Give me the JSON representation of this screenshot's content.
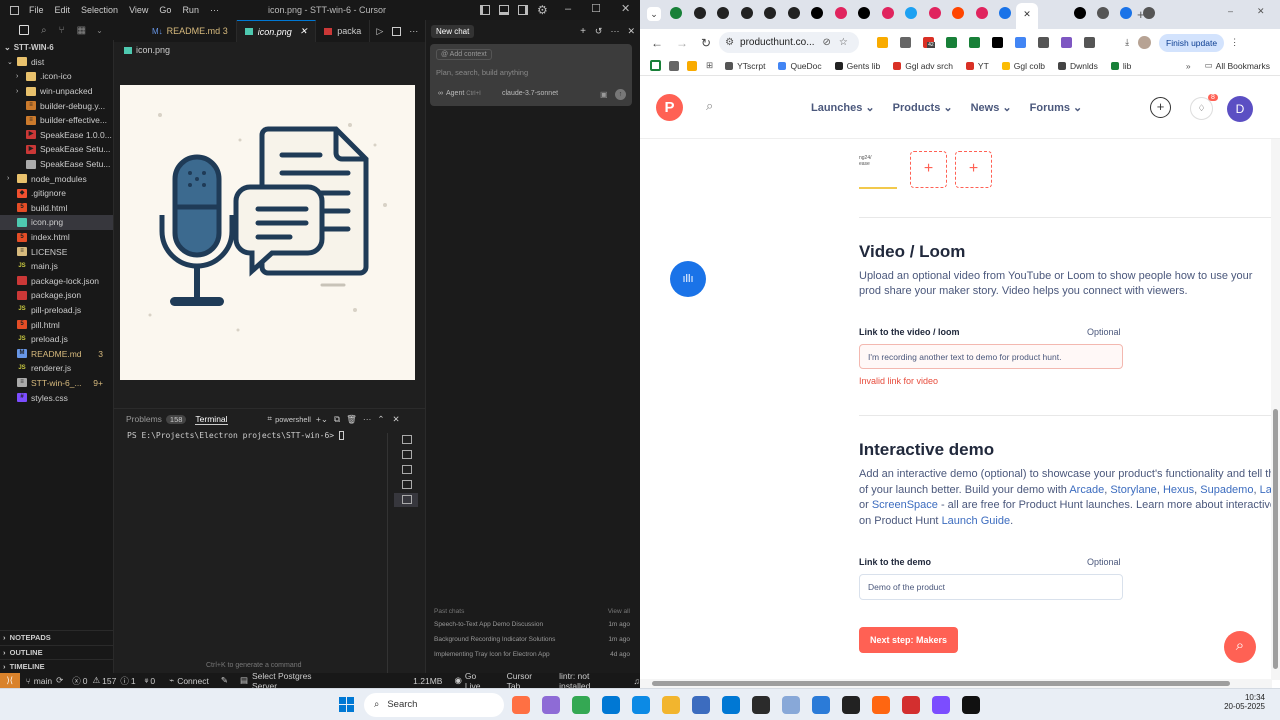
{
  "vscode": {
    "menu": [
      "File",
      "Edit",
      "Selection",
      "View",
      "Go",
      "Run",
      "···"
    ],
    "window_title": "icon.png - STT-win-6 - Cursor",
    "tabs": [
      {
        "label": "README.md",
        "badge": "3"
      },
      {
        "label": "icon.png"
      },
      {
        "label": "packa"
      }
    ],
    "breadcrumb": "icon.png",
    "explorer_root": "STT-WIN-6",
    "tree": [
      {
        "label": "dist",
        "indent": 1,
        "icon": "chev-down",
        "kind": "folder"
      },
      {
        "label": ".icon-ico",
        "indent": 2,
        "icon": "chev",
        "kind": "folder"
      },
      {
        "label": "win-unpacked",
        "indent": 2,
        "icon": "chev",
        "kind": "folder"
      },
      {
        "label": "builder-debug.y...",
        "indent": 2,
        "kind": "yml"
      },
      {
        "label": "builder-effective...",
        "indent": 2,
        "kind": "yml"
      },
      {
        "label": "SpeakEase 1.0.0...",
        "indent": 2,
        "kind": "exe"
      },
      {
        "label": "SpeakEase Setu...",
        "indent": 2,
        "kind": "exe"
      },
      {
        "label": "SpeakEase Setu...",
        "indent": 2,
        "kind": "file"
      },
      {
        "label": "node_modules",
        "indent": 1,
        "icon": "chev",
        "kind": "folder"
      },
      {
        "label": ".gitignore",
        "indent": 1,
        "kind": "git"
      },
      {
        "label": "build.html",
        "indent": 1,
        "kind": "html"
      },
      {
        "label": "icon.png",
        "indent": 1,
        "kind": "img",
        "selected": true
      },
      {
        "label": "index.html",
        "indent": 1,
        "kind": "html"
      },
      {
        "label": "LICENSE",
        "indent": 1,
        "kind": "lic"
      },
      {
        "label": "main.js",
        "indent": 1,
        "kind": "js"
      },
      {
        "label": "package-lock.json",
        "indent": 1,
        "kind": "npm"
      },
      {
        "label": "package.json",
        "indent": 1,
        "kind": "npm"
      },
      {
        "label": "pill-preload.js",
        "indent": 1,
        "kind": "js"
      },
      {
        "label": "pill.html",
        "indent": 1,
        "kind": "html"
      },
      {
        "label": "preload.js",
        "indent": 1,
        "kind": "js"
      },
      {
        "label": "README.md",
        "indent": 1,
        "kind": "md",
        "badge": "3",
        "modified": true
      },
      {
        "label": "renderer.js",
        "indent": 1,
        "kind": "js"
      },
      {
        "label": "STT-win-6_...",
        "indent": 1,
        "kind": "txt",
        "badge": "9+",
        "modified": true
      },
      {
        "label": "styles.css",
        "indent": 1,
        "kind": "css"
      }
    ],
    "sidebar_sections": [
      "NOTEPADS",
      "OUTLINE",
      "TIMELINE"
    ],
    "panel": {
      "problems": "Problems",
      "problems_count": "158",
      "terminal": "Terminal",
      "shell": "powershell",
      "prompt": "PS E:\\Projects\\Electron projects\\STT-win-6> "
    },
    "hint": "Ctrl+K to generate a command",
    "chat": {
      "title": "New chat",
      "add_context": "Add context",
      "placeholder": "Plan, search, build anything",
      "agent": "Agent",
      "agent_key": "Ctrl+I",
      "model": "claude-3.7-sonnet",
      "past_label": "Past chats",
      "view_all": "View all",
      "past": [
        {
          "title": "Speech-to-Text App Demo Discussion",
          "age": "1m ago"
        },
        {
          "title": "Background Recording Indicator Solutions",
          "age": "1m ago"
        },
        {
          "title": "Implementing Tray Icon for Electron App",
          "age": "4d ago"
        }
      ]
    },
    "status": {
      "branch": "main",
      "errors": "0",
      "warnings": "157",
      "info": "1",
      "ports": "0",
      "connect": "Connect",
      "postgres": "Select Postgres Server",
      "size": "1.21MB",
      "golive": "Go Live",
      "cursortab": "Cursor Tab",
      "lint": "lintr: not installed"
    }
  },
  "chrome": {
    "url": "producthunt.co...",
    "finish_update": "Finish update",
    "bookmarks": [
      "YTscrpt",
      "QueDoc",
      "Gents lib",
      "Ggl adv srch",
      "YT",
      "Ggl colb",
      "Dwnlds",
      "lib"
    ],
    "all_bookmarks": "All Bookmarks",
    "ext_badge": "42"
  },
  "ph": {
    "nav": [
      "Launches",
      "Products",
      "News",
      "Forums"
    ],
    "notif_count": "8",
    "avatar": "D",
    "video_title": "Video / Loom",
    "video_desc": "Upload an optional video from YouTube or Loom to show people how to use your prod share your maker story. Video helps you connect with viewers.",
    "video_label": "Link to the video / loom",
    "optional": "Optional",
    "video_value": "I'm recording another text to demo for product hunt.",
    "video_error": "Invalid link for video",
    "demo_title": "Interactive demo",
    "demo_desc_1": "Add an interactive demo (optional) to showcase your product's functionality and tell the",
    "demo_desc_2a": "of your launch better. Build your demo with ",
    "demo_links": [
      "Arcade",
      "Storylane",
      "Hexus",
      "Supademo",
      "Layer"
    ],
    "demo_desc_3a": "or ",
    "demo_link_ss": "ScreenSpace",
    "demo_desc_3b": " - all are free for Product Hunt launches. Learn more about interactive de",
    "demo_desc_4a": "on Product Hunt ",
    "demo_link_guide": "Launch Guide",
    "demo_label": "Link to the demo",
    "demo_value": "Demo of the product",
    "next": "Next step: Makers",
    "thumb_text": "ng24/\nease"
  },
  "taskbar": {
    "search": "Search",
    "time": "10:34",
    "date": "20-05-2025"
  },
  "colors": {
    "ph_orange": "#ff6154",
    "accent_blue": "#0b57d0",
    "vscode_status": "#181818"
  }
}
